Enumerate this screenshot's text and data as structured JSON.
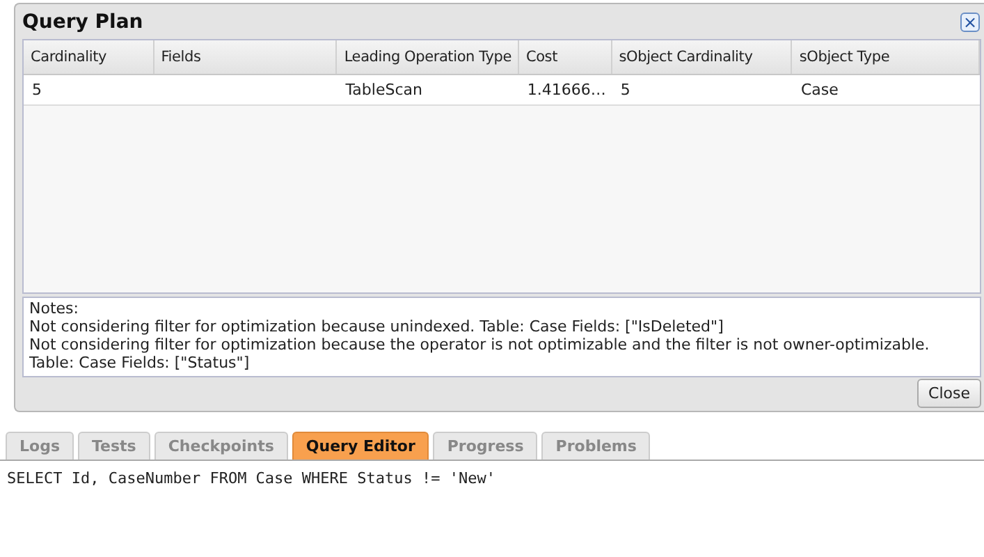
{
  "dialog": {
    "title": "Query Plan",
    "close_icon": "×",
    "table": {
      "columns": [
        "Cardinality",
        "Fields",
        "Leading Operation Type",
        "Cost",
        "sObject Cardinality",
        "sObject Type"
      ],
      "rows": [
        [
          "5",
          "",
          "TableScan",
          "1.41666…",
          "5",
          "Case"
        ]
      ]
    },
    "notes": [
      "Notes:",
      "Not considering filter for optimization because unindexed. Table: Case Fields: [\"IsDeleted\"]",
      "Not considering filter for optimization because the operator is not optimizable and the filter is not owner-optimizable. Table: Case Fields: [\"Status\"]"
    ],
    "close_button": "Close"
  },
  "tabs": [
    {
      "label": "Logs",
      "selected": false
    },
    {
      "label": "Tests",
      "selected": false
    },
    {
      "label": "Checkpoints",
      "selected": false
    },
    {
      "label": "Query Editor",
      "selected": true
    },
    {
      "label": "Progress",
      "selected": false
    },
    {
      "label": "Problems",
      "selected": false
    }
  ],
  "editor": {
    "value": "SELECT Id, CaseNumber FROM Case WHERE Status != 'New'"
  }
}
